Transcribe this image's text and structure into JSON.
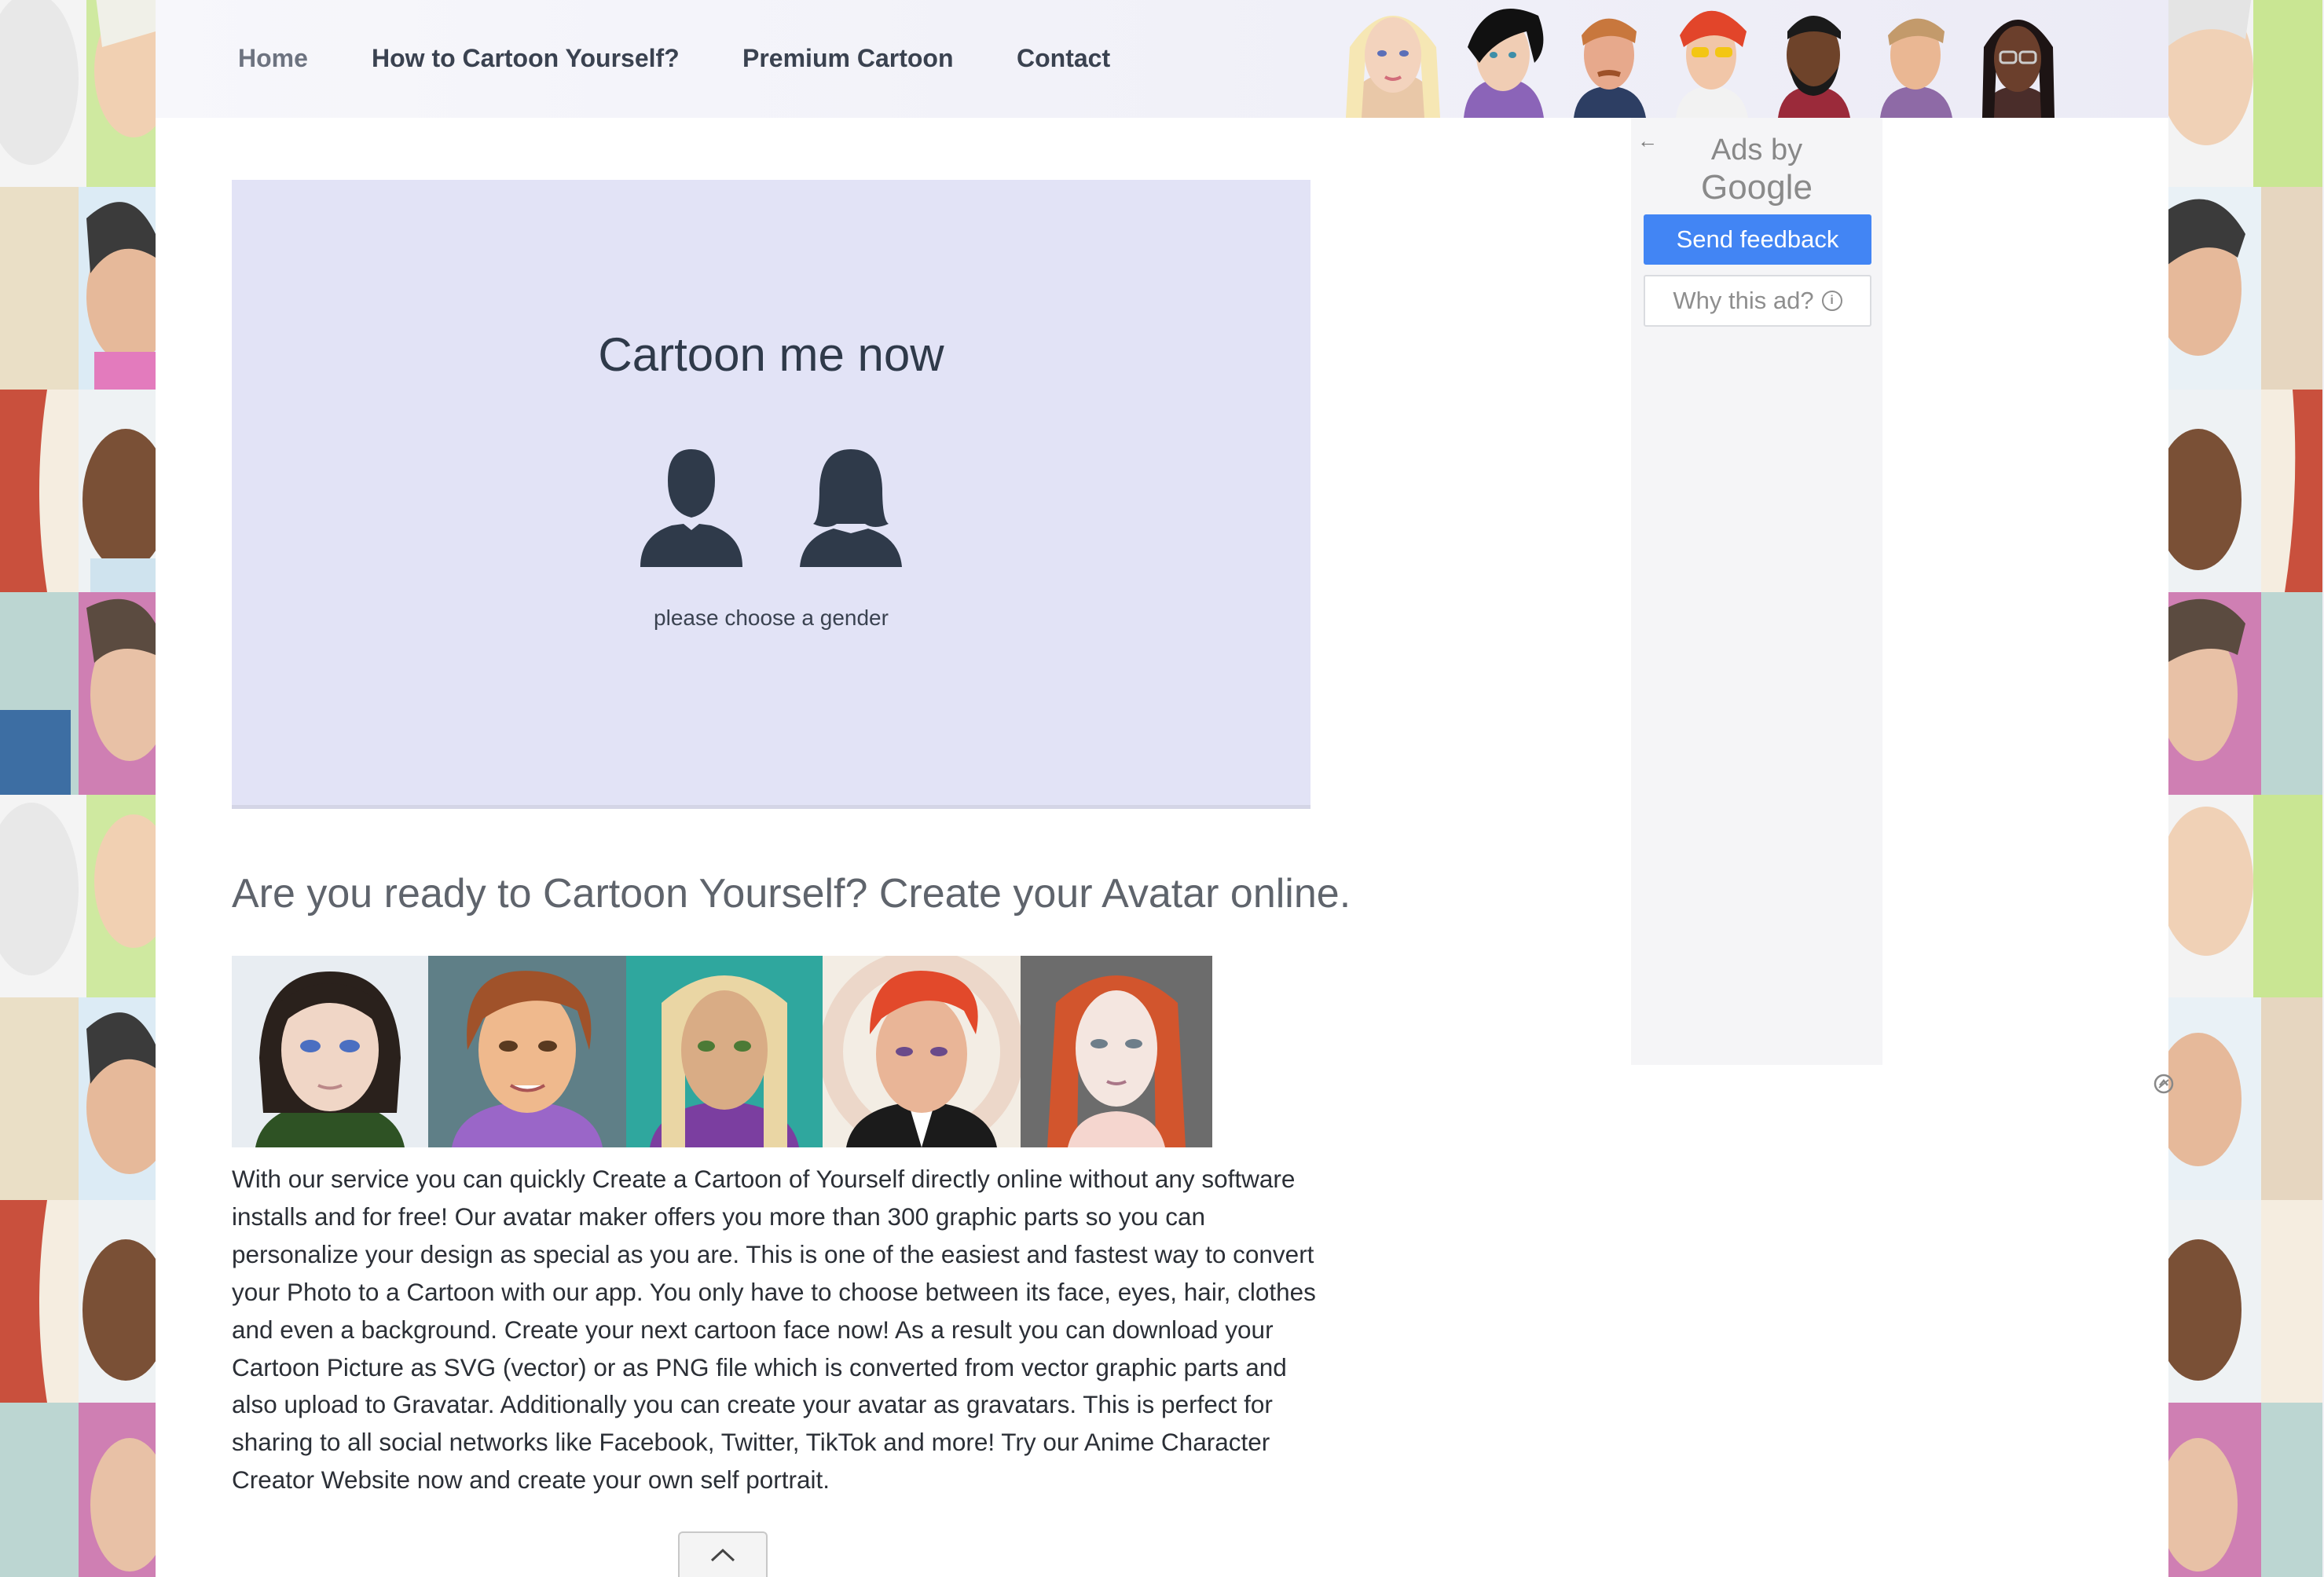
{
  "nav": {
    "links": [
      "Home",
      "How to Cartoon Yourself?",
      "Premium Cartoon",
      "Contact"
    ]
  },
  "editor": {
    "title": "Cartoon me now",
    "hint": "please choose a gender",
    "icons": [
      "male-silhouette-icon",
      "female-silhouette-icon"
    ]
  },
  "main": {
    "headline": "Are you ready to Cartoon Yourself? Create your Avatar online.",
    "description": "With our service you can quickly Create a Cartoon of Yourself directly online without any software installs and for free! Our avatar maker offers you more than 300 graphic parts so you can personalize your design as special as you are. This is one of the easiest and fastest way to convert your Photo to a Cartoon with our app. You only have to choose between its face, eyes, hair, clothes and even a background. Create your next cartoon face now! As a result you can download your Cartoon Picture as SVG (vector) or as PNG file which is converted from vector graphic parts and also upload to Gravatar. Additionally you can create your avatar as gravatars. This is perfect for sharing to all social networks like Facebook, Twitter, TikTok and more! Try our Anime Character Creator Website now and create your own self portrait."
  },
  "ad": {
    "ads_by": "Ads by",
    "google": "Google",
    "send_feedback": "Send feedback",
    "why_this_ad": "Why this ad?",
    "info_glyph": "i",
    "back_glyph": "←"
  },
  "colors": {
    "editor_bg": "#e2e3f6",
    "send_feedback_bg": "#4285f4",
    "silhouette": "#2f3a4a"
  }
}
